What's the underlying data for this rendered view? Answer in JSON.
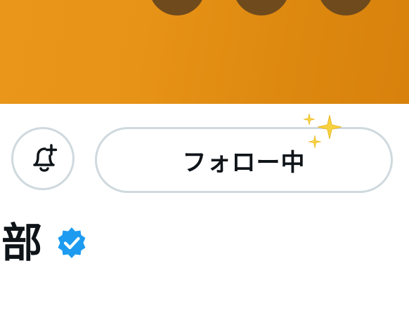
{
  "header": {
    "banner_color": "#e79317",
    "avatar_overlay_color": "#6f4a1d"
  },
  "actions": {
    "notify_icon": "bell-plus-icon",
    "follow_label": "フォロー中",
    "decoration_icon": "sparkles-icon",
    "sparkle_color": "#f7d13f",
    "border_color": "#cfd9de"
  },
  "profile": {
    "name": "部",
    "verified_icon": "verified-badge-icon",
    "verified_color": "#1d9bf0"
  }
}
